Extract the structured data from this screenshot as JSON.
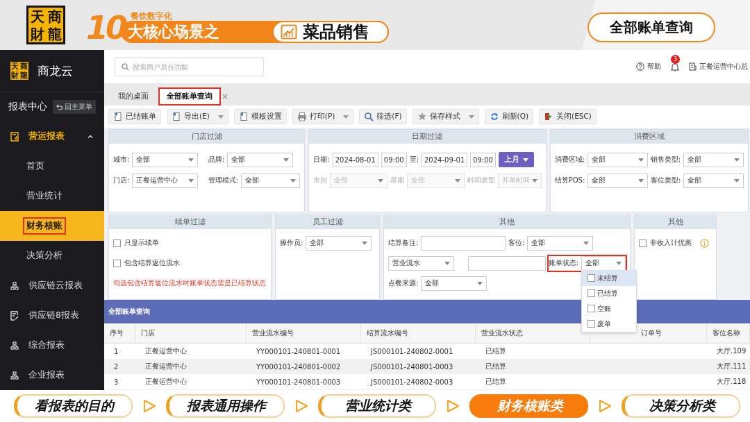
{
  "banner": {
    "logo": [
      "天",
      "商",
      "財",
      "龍"
    ],
    "number": "10",
    "kicker": "餐饮数字化",
    "headline": "大核心场景之",
    "topic": "菜品销售",
    "page_title": "全部账单查询"
  },
  "header": {
    "search_placeholder": "搜索商户后台功能",
    "help": "帮助",
    "notifications": "3",
    "org": "正餐运营中心总"
  },
  "sidebar": {
    "brand_logo": [
      "天",
      "商",
      "財",
      "龍"
    ],
    "brand": "商龙云",
    "title": "报表中心",
    "back": "回主菜单",
    "groups": [
      {
        "label": "营运报表",
        "kind": "report",
        "active": true,
        "expanded": true,
        "children": [
          {
            "label": "首页",
            "selected": false,
            "highlighted": false
          },
          {
            "label": "营业统计",
            "selected": false,
            "highlighted": false
          },
          {
            "label": "财务核账",
            "selected": true,
            "highlighted": true
          },
          {
            "label": "决策分析",
            "selected": false,
            "highlighted": false
          }
        ]
      },
      {
        "label": "供应链云报表",
        "kind": "tree",
        "active": false,
        "expanded": false
      },
      {
        "label": "供应链8报表",
        "kind": "form",
        "active": false,
        "expanded": false
      },
      {
        "label": "综合报表",
        "kind": "tree",
        "active": false,
        "expanded": false
      },
      {
        "label": "企业报表",
        "kind": "tree",
        "active": false,
        "expanded": false
      }
    ]
  },
  "tabs": [
    {
      "label": "我的桌面",
      "selected": false,
      "highlighted": false,
      "closable": false
    },
    {
      "label": "全部账单查询",
      "selected": true,
      "highlighted": true,
      "closable": true
    }
  ],
  "toolbar": [
    {
      "label": "已结账单",
      "kind": "doc",
      "dropdown": false
    },
    {
      "label": "导出(E)",
      "kind": "doc",
      "dropdown": true
    },
    {
      "label": "模板设置",
      "kind": "doc",
      "dropdown": false
    },
    {
      "label": "打印(P)",
      "kind": "print",
      "dropdown": true
    },
    {
      "label": "筛选(F)",
      "kind": "search",
      "dropdown": false
    },
    {
      "label": "保存样式",
      "kind": "star",
      "dropdown": true
    },
    {
      "label": "刷新(Q)",
      "kind": "refresh",
      "dropdown": false
    },
    {
      "label": "关闭(ESC)",
      "kind": "exit",
      "dropdown": false
    }
  ],
  "filter_rows": [
    [
      {
        "title": "门店过滤",
        "lines": [
          {
            "fields": [
              {
                "kind": "select",
                "label": "城市:",
                "value": "全部",
                "disabled": false
              },
              {
                "kind": "select",
                "label": "品牌:",
                "value": "全部",
                "disabled": false
              }
            ]
          },
          {
            "fields": [
              {
                "kind": "select",
                "label": "门店:",
                "value": "正餐运营中心",
                "disabled": false
              },
              {
                "kind": "select",
                "label": "管理模式:",
                "value": "全部",
                "disabled": false
              }
            ]
          }
        ]
      },
      {
        "title": "日期过滤",
        "lines": [
          {
            "fields": [
              {
                "kind": "input",
                "label": "日期:",
                "value": "2024-08-01"
              },
              {
                "kind": "input",
                "value": "09:00"
              },
              {
                "kind": "input",
                "label": "至:",
                "value": "2024-09-01"
              },
              {
                "kind": "input",
                "value": "09:00"
              },
              {
                "kind": "button",
                "label": "上月"
              }
            ]
          },
          {
            "fields": [
              {
                "kind": "select",
                "label": "市别",
                "value": "全部",
                "disabled": true
              },
              {
                "kind": "select",
                "label": "星期",
                "value": "全部",
                "disabled": true
              },
              {
                "kind": "select",
                "label": "时间类型",
                "value": "开单时间",
                "disabled": true
              }
            ]
          }
        ]
      },
      {
        "title": "消费区域",
        "lines": [
          {
            "fields": [
              {
                "kind": "select",
                "label": "消费区域:",
                "value": "全部",
                "disabled": false
              },
              {
                "kind": "select",
                "label": "销售类型:",
                "value": "全部",
                "disabled": false
              }
            ]
          },
          {
            "fields": [
              {
                "kind": "select",
                "label": "结算POS:",
                "value": "全部",
                "disabled": false
              },
              {
                "kind": "select",
                "label": "客位类型:",
                "value": "全部",
                "disabled": false
              }
            ]
          }
        ]
      }
    ],
    [
      {
        "title": "续单过滤",
        "lines": [
          {
            "fields": [
              {
                "kind": "checkbox",
                "label": "只显示续单",
                "checked": false
              }
            ]
          },
          {
            "fields": [
              {
                "kind": "checkbox",
                "label": "包含结算返位流水",
                "checked": false
              }
            ]
          },
          {
            "fields": [
              {
                "kind": "note",
                "text": "勾选包含结算返位流水时账单状态需是已结算状态"
              }
            ]
          }
        ]
      },
      {
        "title": "员工过滤",
        "lines": [
          {
            "fields": [
              {
                "kind": "select",
                "label": "操作员:",
                "value": "全部",
                "disabled": false
              }
            ]
          }
        ]
      },
      {
        "title": "其他",
        "lines": [
          {
            "fields": [
              {
                "kind": "input",
                "label": "结算备注:"
              },
              {
                "kind": "select",
                "label": "客位:",
                "value": "全部",
                "disabled": false
              }
            ]
          },
          {
            "fields": [
              {
                "kind": "select",
                "value": "营业流水",
                "disabled": false
              },
              {
                "kind": "input"
              },
              {
                "kind": "select",
                "label": "账单状态:",
                "value": "全部",
                "disabled": false,
                "highlighted": true
              }
            ]
          },
          {
            "fields": [
              {
                "kind": "select",
                "label": "点餐来源:",
                "value": "全部",
                "disabled": false
              }
            ]
          }
        ]
      },
      {
        "title": "其他",
        "lines": [
          {
            "fields": [
              {
                "kind": "checkbox",
                "label": "非收入计优惠",
                "checked": false
              },
              {
                "kind": "info"
              }
            ]
          }
        ]
      }
    ]
  ],
  "status_dropdown": {
    "options": [
      {
        "label": "未结算",
        "checked": false,
        "selected": true
      },
      {
        "label": "已结算",
        "checked": false,
        "selected": false
      },
      {
        "label": "空账",
        "checked": false,
        "selected": false
      },
      {
        "label": "废单",
        "checked": false,
        "selected": false
      }
    ]
  },
  "table": {
    "title": "全部账单查询",
    "columns": [
      "序号",
      "门店",
      "营业流水编号",
      "结算流水编号",
      "营业流水状态",
      "订单号",
      "客位名称"
    ],
    "rows": [
      [
        "1",
        "正餐运营中心",
        "YY000101-240801-0001",
        "JS000101-240802-0001",
        "已结算",
        null,
        "大厅.109"
      ],
      [
        "2",
        "正餐运营中心",
        "YY000101-240801-0002",
        "JS000101-240801-0003",
        "已结算",
        null,
        "大厅.111"
      ],
      [
        "3",
        "正餐运营中心",
        "YY000101-240801-0003",
        "JS000101-240802-0003",
        "已结算",
        null,
        "大厅.118"
      ]
    ]
  },
  "steps": [
    {
      "label": "看报表的目的",
      "selected": false
    },
    {
      "label": "报表通用操作",
      "selected": false
    },
    {
      "label": "营业统计类",
      "selected": false
    },
    {
      "label": "财务核账类",
      "selected": true
    },
    {
      "label": "决策分析类",
      "selected": false
    }
  ]
}
